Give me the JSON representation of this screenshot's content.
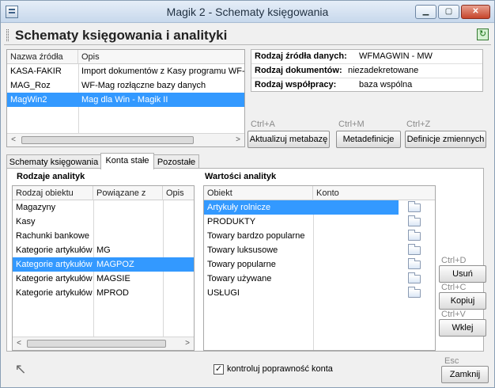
{
  "window": {
    "title": "Magik 2 - Schematy księgowania",
    "min_symbol": "▁",
    "max_symbol": "▢",
    "close_symbol": "✕"
  },
  "header": {
    "title": "Schematy księgowania i analityki",
    "refresh_icon": "↻"
  },
  "sources_grid": {
    "columns": [
      "Nazwa źródła",
      "Opis"
    ],
    "rows": [
      {
        "name": "KASA-FAKIR",
        "desc": "Import dokumentów z Kasy programu WF-Fa"
      },
      {
        "name": "MAG_Roz",
        "desc": "WF-Mag rozłączne bazy danych"
      },
      {
        "name": "MagWin2",
        "desc": "Mag dla Win - Magik II"
      }
    ],
    "selected_index": 2
  },
  "info": {
    "rows": [
      {
        "label": "Rodzaj źródła danych:",
        "value": "WFMAGWIN - MW"
      },
      {
        "label": "Rodzaj dokumentów:",
        "value": "niezadekretowane"
      },
      {
        "label": "Rodzaj współpracy:",
        "value": "baza wspólna"
      }
    ]
  },
  "top_buttons": [
    {
      "shortcut": "Ctrl+A",
      "label": "Aktualizuj metabazę"
    },
    {
      "shortcut": "Ctrl+M",
      "label": "Metadefinicje"
    },
    {
      "shortcut": "Ctrl+Z",
      "label": "Definicje zmiennych"
    }
  ],
  "tabs": [
    {
      "label": "Schematy księgowania"
    },
    {
      "label": "Konta stałe"
    },
    {
      "label": "Pozostałe"
    }
  ],
  "active_tab_index": 1,
  "analytics_types": {
    "title": "Rodzaje analityk",
    "columns": [
      "Rodzaj obiektu",
      "Powiązane z",
      "Opis"
    ],
    "rows": [
      {
        "type": "Magazyny",
        "linked": "",
        "desc": ""
      },
      {
        "type": "Kasy",
        "linked": "",
        "desc": ""
      },
      {
        "type": "Rachunki bankowe",
        "linked": "",
        "desc": ""
      },
      {
        "type": "Kategorie artykułów",
        "linked": "MG",
        "desc": ""
      },
      {
        "type": "Kategorie artykułów",
        "linked": "MAGPOZ",
        "desc": ""
      },
      {
        "type": "Kategorie artykułów",
        "linked": "MAGSIE",
        "desc": ""
      },
      {
        "type": "Kategorie artykułów",
        "linked": "MPROD",
        "desc": ""
      }
    ],
    "selected_index": 4
  },
  "analytics_values": {
    "title": "Wartości analityk",
    "columns": [
      "Obiekt",
      "Konto"
    ],
    "rows": [
      {
        "object": "Artykuły rolnicze",
        "account": ""
      },
      {
        "object": "PRODUKTY",
        "account": ""
      },
      {
        "object": "Towary bardzo popularne",
        "account": ""
      },
      {
        "object": "Towary luksusowe",
        "account": ""
      },
      {
        "object": "Towary popularne",
        "account": ""
      },
      {
        "object": "Towary używane",
        "account": ""
      },
      {
        "object": "USŁUGI",
        "account": ""
      }
    ],
    "selected_index": 0
  },
  "side_buttons": [
    {
      "shortcut": "Ctrl+D",
      "label": "Usuń"
    },
    {
      "shortcut": "Ctrl+C",
      "label": "Kopiuj"
    },
    {
      "shortcut": "Ctrl+V",
      "label": "Wklej"
    }
  ],
  "footer": {
    "checkbox_label": "kontroluj poprawność konta",
    "checkbox_checked": true,
    "check_mark": "✓",
    "close_shortcut": "Esc",
    "close_label": "Zamknij",
    "cursor_icon": "↖"
  },
  "scroll": {
    "left_arrow": "<",
    "right_arrow": ">"
  },
  "colors": {
    "selection": "#3399ff",
    "window_bg": "#f0f0f0",
    "close_button": "#c7452b"
  }
}
